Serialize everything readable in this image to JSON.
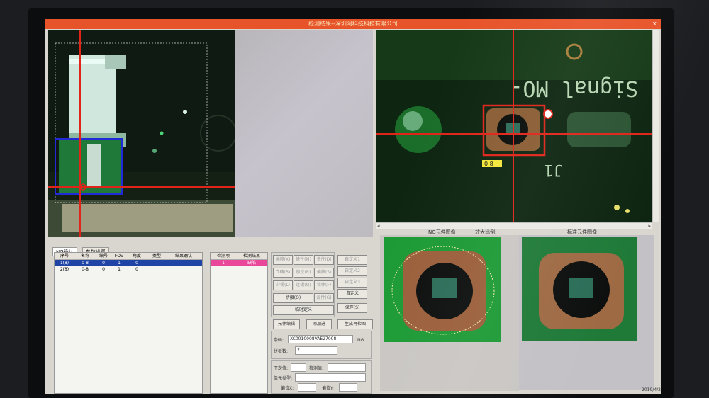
{
  "window": {
    "title": "检测结果--深圳阿科技科技有限公司",
    "close_label": "x"
  },
  "camera_views": {
    "main_view_marker": "0 8",
    "pcb_silkscreen": "Signal MO-",
    "pcb_label2": "J1"
  },
  "image_tabs": {
    "ng_image": "NG元件图像",
    "enlarge": "放大比例:",
    "standard_image": "标准元件图像"
  },
  "left_tabs": [
    {
      "label": "NG确认"
    },
    {
      "label": "参数设置"
    }
  ],
  "ng_table": {
    "headers": [
      "序号",
      "名称",
      "编号",
      "FOV",
      "角度",
      "类型",
      "结果确认"
    ],
    "rows": [
      [
        "1(8)",
        "0-8",
        "0",
        "1",
        "0",
        "",
        ""
      ],
      [
        "2(8)",
        "0-8",
        "0",
        "1",
        "0",
        "",
        ""
      ]
    ]
  },
  "result_table": {
    "headers": [
      "检测项",
      "检测结果"
    ],
    "rows": [
      [
        "1",
        "缺陷"
      ]
    ]
  },
  "buttons": {
    "b1": "偏移(X)",
    "b2": "缺件(M)",
    "b3": "多件(D)",
    "b4": "立碑(B)",
    "b5": "极反(R)",
    "b6": "偏移(S)",
    "b7": "少锡(L)",
    "b8": "连锡(Q)",
    "b9": "错件(F)",
    "b10": "桥接(O)",
    "b11": "漏件(G)",
    "custom1": "自定义1",
    "custom2": "自定义2",
    "custom3": "自定义3",
    "custom4": "自定义",
    "temp_define": "临时定义",
    "save": "保存(S)",
    "part_edit": "元件编辑",
    "add_pass": "添加进",
    "gen_report": "生成再检图"
  },
  "fields": {
    "barcode_label": "条码:",
    "barcode_value": "XC0010008VAE27008",
    "ng_label": "NG",
    "board_count_label": "拼板数:",
    "board_count_value": "2",
    "next_label": "下次值:",
    "check_value_label": "检测值:",
    "unit_type_label": "单元类型:",
    "offset_x_label": "偏位X:",
    "offset_y_label": "偏位Y:"
  },
  "tray": {
    "text": "2019/4/2"
  },
  "colors": {
    "title_bar": "#e8542a",
    "crosshair": "#e0241a",
    "select_blue": "#1f44a6",
    "select_pink": "#e9479a"
  }
}
